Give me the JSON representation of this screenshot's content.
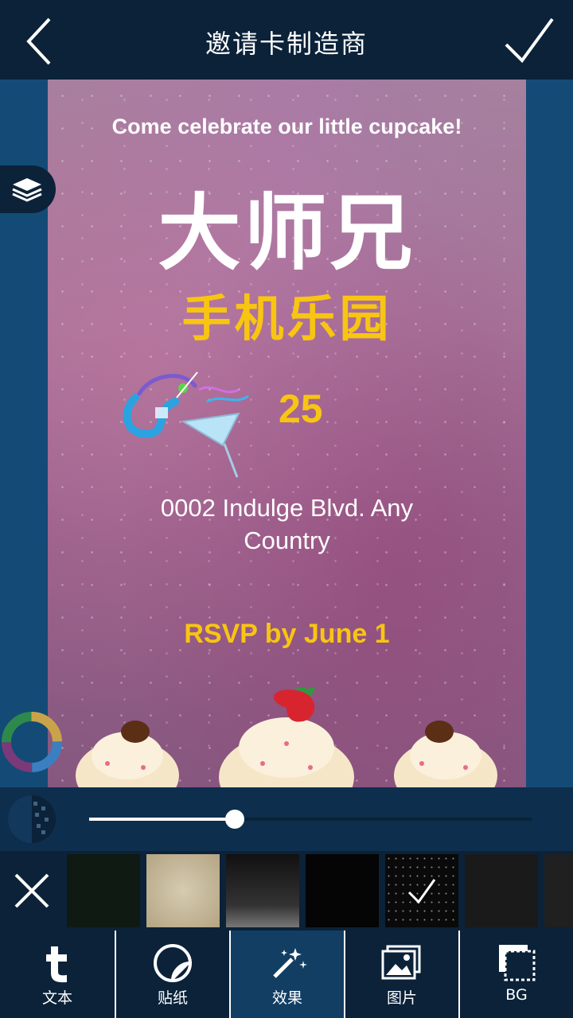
{
  "app": {
    "title": "邀请卡制造商"
  },
  "card": {
    "tagline": "Come celebrate our little cupcake!",
    "headline": "大师兄",
    "subheadline": "手机乐园",
    "number": "25",
    "address": "0002 Indulge Blvd. Any Country",
    "rsvp": "RSVP by June 1"
  },
  "slider": {
    "value": 0.33
  },
  "textures": {
    "items": [
      {
        "name": "dark-green-grunge",
        "color": "#0f1a12"
      },
      {
        "name": "vintage-paper",
        "color": "#c3b69a"
      },
      {
        "name": "dark-vignette",
        "color": "#2a2a2a"
      },
      {
        "name": "black-noise",
        "color": "#050505"
      },
      {
        "name": "starfield",
        "color": "#0a0a0a",
        "selected": true
      },
      {
        "name": "charcoal",
        "color": "#1a1a1a"
      },
      {
        "name": "dark-edge",
        "color": "#202020"
      }
    ]
  },
  "nav": {
    "items": [
      {
        "label": "文本",
        "icon": "text-icon"
      },
      {
        "label": "贴纸",
        "icon": "sticker-icon"
      },
      {
        "label": "效果",
        "icon": "magic-wand-icon",
        "active": true
      },
      {
        "label": "图片",
        "icon": "image-icon"
      },
      {
        "label": "BG",
        "icon": "background-icon"
      }
    ]
  },
  "colors": {
    "accent_yellow": "#f8c512",
    "bar_dark": "#0b2239",
    "workspace_blue": "#134b76"
  }
}
